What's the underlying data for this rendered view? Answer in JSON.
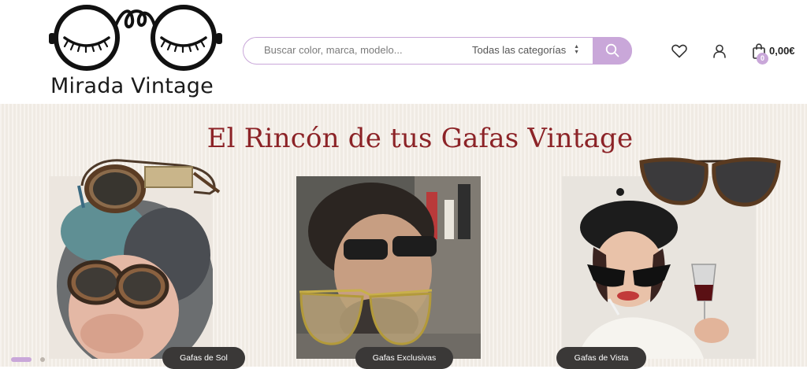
{
  "brand": {
    "name": "Mirada Vintage"
  },
  "search": {
    "placeholder": "Buscar color, marca, modelo...",
    "category": "Todas las categorías"
  },
  "header": {
    "cart_count": "0",
    "cart_total": "0,00€"
  },
  "icons": {
    "search": "search-icon",
    "wishlist": "heart-icon",
    "account": "user-icon",
    "cart": "shopping-bag-icon",
    "select": "updown-arrows-icon"
  },
  "hero": {
    "title": "El Rincón de tus Gafas Vintage",
    "cards": [
      {
        "label": "Gafas de Sol"
      },
      {
        "label": "Gafas Exclusivas"
      },
      {
        "label": "Gafas de Vista"
      }
    ],
    "slider": {
      "slides": 2,
      "active": 1
    }
  },
  "colors": {
    "accent": "#c9a7d9",
    "title": "#8c2327",
    "label_bg": "#3a3837",
    "hero_bg": "#f4efe8"
  }
}
